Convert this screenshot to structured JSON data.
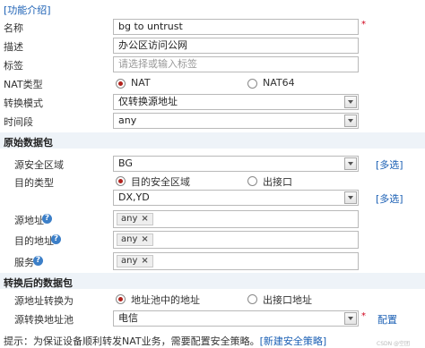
{
  "intro_link": "[功能介绍]",
  "fields": {
    "name": {
      "label": "名称",
      "value": "bg to untrust"
    },
    "description": {
      "label": "描述",
      "value": "办公区访问公网"
    },
    "tag": {
      "label": "标签",
      "placeholder": "请选择或输入标签"
    },
    "nat_type": {
      "label": "NAT类型",
      "options": [
        "NAT",
        "NAT64"
      ],
      "selected": "NAT"
    },
    "convert_mode": {
      "label": "转换模式",
      "value": "仅转换源地址"
    },
    "time_range": {
      "label": "时间段",
      "value": "any"
    }
  },
  "original_packet": {
    "title": "原始数据包",
    "src_zone": {
      "label": "源安全区域",
      "value": "BG",
      "multi_link": "[多选]"
    },
    "dst_type": {
      "label": "目的类型",
      "options": [
        "目的安全区域",
        "出接口"
      ],
      "selected": "目的安全区域"
    },
    "dst_zone": {
      "value": "DX,YD",
      "multi_link": "[多选]"
    },
    "src_address": {
      "label": "源地址",
      "tag": "any"
    },
    "dst_address": {
      "label": "目的地址",
      "tag": "any"
    },
    "service": {
      "label": "服务",
      "tag": "any"
    }
  },
  "translated_packet": {
    "title": "转换后的数据包",
    "src_convert": {
      "label": "源地址转换为",
      "options": [
        "地址池中的地址",
        "出接口地址"
      ],
      "selected": "地址池中的地址"
    },
    "src_pool": {
      "label": "源转换地址池",
      "value": "电信",
      "config_link": "配置"
    }
  },
  "hint": {
    "text": "提示：为保证设备顺利转发NAT业务，需要配置安全策略。",
    "link": "[新建安全策略]"
  },
  "watermark": "CSDN @空团"
}
